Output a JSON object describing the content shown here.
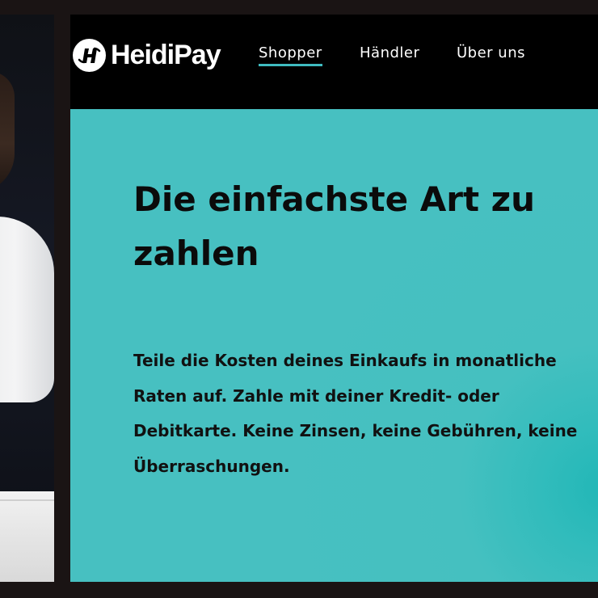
{
  "brand": {
    "name": "HeidiPay",
    "accent_color": "#3fbcc1",
    "hero_background": "#47c0c1",
    "nav_background": "#000000"
  },
  "nav": {
    "items": [
      {
        "label": "Shopper",
        "active": true
      },
      {
        "label": "Händler",
        "active": false
      },
      {
        "label": "Über uns",
        "active": false
      }
    ]
  },
  "hero": {
    "title": "Die einfachste Art zu zahlen",
    "body": "Teile die Kosten deines Einkaufs in monatliche Raten auf. Zahle mit deiner Kredit- oder Debitkarte. Keine Zinsen, keine Gebühren, keine Überraschungen."
  },
  "icons": {
    "logo": "heidipay-logo-icon"
  }
}
